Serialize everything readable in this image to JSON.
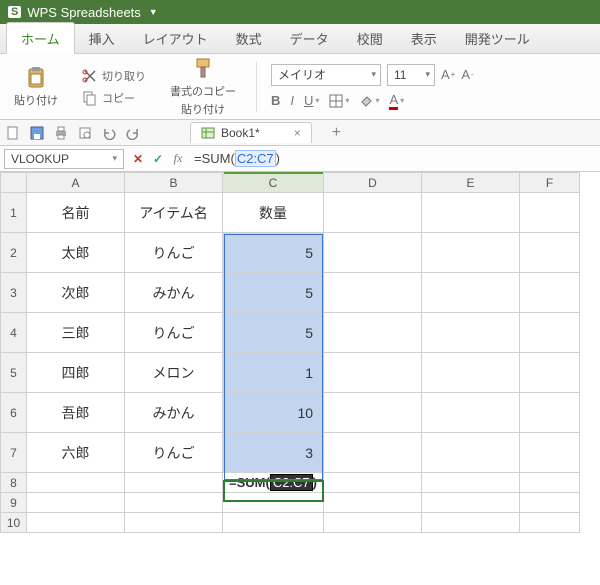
{
  "titlebar": {
    "app_name": "WPS Spreadsheets"
  },
  "tabs": {
    "home": "ホーム",
    "insert": "挿入",
    "layout": "レイアウト",
    "formula": "数式",
    "data": "データ",
    "review": "校閲",
    "view": "表示",
    "developer": "開発ツール"
  },
  "ribbon": {
    "paste": "貼り付け",
    "cut": "切り取り",
    "copy": "コピー",
    "format_painter_l1": "書式のコピー",
    "format_painter_l2": "貼り付け",
    "font_name": "メイリオ",
    "font_size": "11"
  },
  "doc": {
    "tab_name": "Book1*"
  },
  "formulabar": {
    "namebox": "VLOOKUP",
    "formula_prefix": "=SUM(",
    "formula_arg": "C2:C7",
    "formula_suffix": ")"
  },
  "grid": {
    "columns": [
      "A",
      "B",
      "C",
      "D",
      "E",
      "F"
    ],
    "row_numbers": [
      "1",
      "2",
      "3",
      "4",
      "5",
      "6",
      "7",
      "8",
      "9",
      "10"
    ],
    "headers": {
      "A": "名前",
      "B": "アイテム名",
      "C": "数量"
    },
    "rows": [
      {
        "A": "太郎",
        "B": "りんご",
        "C": 5
      },
      {
        "A": "次郎",
        "B": "みかん",
        "C": 5
      },
      {
        "A": "三郎",
        "B": "りんご",
        "C": 5
      },
      {
        "A": "四郎",
        "B": "メロン",
        "C": 1
      },
      {
        "A": "吾郎",
        "B": "みかん",
        "C": 10
      },
      {
        "A": "六郎",
        "B": "りんご",
        "C": 3
      }
    ],
    "active_cell_formula": {
      "prefix": "=SUM(",
      "arg": "C2:C7",
      "suffix": ")"
    }
  },
  "chart_data": {
    "type": "table",
    "columns": [
      "名前",
      "アイテム名",
      "数量"
    ],
    "rows": [
      [
        "太郎",
        "りんご",
        5
      ],
      [
        "次郎",
        "みかん",
        5
      ],
      [
        "三郎",
        "りんご",
        5
      ],
      [
        "四郎",
        "メロン",
        1
      ],
      [
        "吾郎",
        "みかん",
        10
      ],
      [
        "六郎",
        "りんご",
        3
      ]
    ]
  }
}
